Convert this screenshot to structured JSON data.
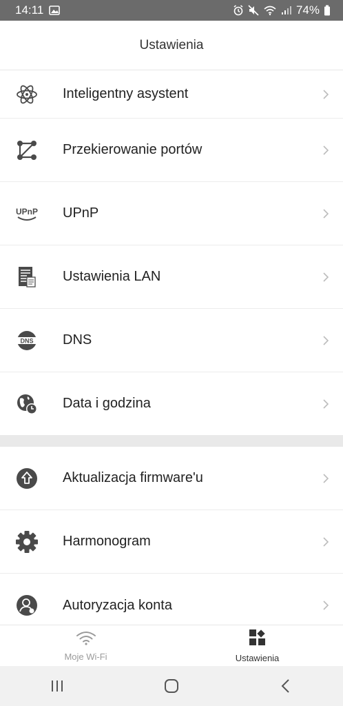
{
  "status_bar": {
    "time": "14:11",
    "battery": "74%",
    "icons": [
      "image-icon",
      "alarm-icon",
      "mute-icon",
      "wifi-icon",
      "signal-icon",
      "battery-icon"
    ]
  },
  "header": {
    "title": "Ustawienia"
  },
  "settings": {
    "group1": [
      {
        "label": "Inteligentny asystent",
        "icon": "atom-icon"
      },
      {
        "label": "Przekierowanie portów",
        "icon": "nodes-icon"
      },
      {
        "label": "UPnP",
        "icon": "upnp-icon"
      },
      {
        "label": "Ustawienia LAN",
        "icon": "lan-document-icon"
      },
      {
        "label": "DNS",
        "icon": "dns-icon"
      },
      {
        "label": "Data i godzina",
        "icon": "globe-clock-icon"
      }
    ],
    "group2": [
      {
        "label": "Aktualizacja firmware'u",
        "icon": "upload-arrow-icon"
      },
      {
        "label": "Harmonogram",
        "icon": "gear-icon"
      },
      {
        "label": "Autoryzacja konta",
        "icon": "account-icon"
      }
    ]
  },
  "tabs": [
    {
      "label": "Moje Wi-Fi",
      "icon": "wifi-icon",
      "active": false
    },
    {
      "label": "Ustawienia",
      "icon": "grid-icon",
      "active": true
    }
  ],
  "icon_text": {
    "upnp": "UPnP",
    "dns": "DNS"
  },
  "colors": {
    "icon": "#4a4a4a",
    "statusbar": "#6b6b6b",
    "chevron": "#bcbcbc",
    "inactive_tab": "#9a9a9a"
  }
}
